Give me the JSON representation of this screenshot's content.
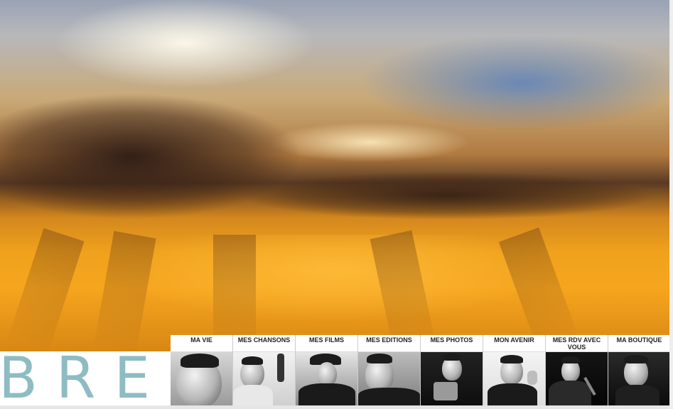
{
  "logo": {
    "text": "BREL",
    "color": "#8fbcc3"
  },
  "nav": {
    "items": [
      {
        "label": "MA VIE"
      },
      {
        "label": "MES CHANSONS"
      },
      {
        "label": "MES FILMS"
      },
      {
        "label": "MES EDITIONS"
      },
      {
        "label": "MES PHOTOS"
      },
      {
        "label": "MON AVENIR"
      },
      {
        "label": "MES RDV AVEC VOUS"
      },
      {
        "label": "MA BOUTIQUE"
      }
    ]
  },
  "colors": {
    "sky_orange": "#f0a21c",
    "cloud_dark": "#3c2418",
    "sky_blue": "#5a82be"
  }
}
